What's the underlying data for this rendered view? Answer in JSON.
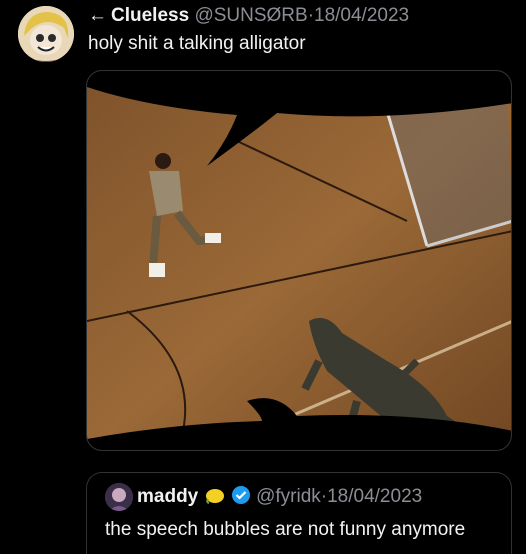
{
  "tweet": {
    "back_arrow": "←",
    "display_name": "Clueless",
    "handle": "@SUNSØRB",
    "separator": "·",
    "date": "18/04/2023",
    "text": "holy shit a talking alligator",
    "avatar_icon": "anime-avatar-icon",
    "media_description_icons": [
      "speech-bubble-icon",
      "alligator-icon"
    ]
  },
  "quote": {
    "display_name": "maddy",
    "handle": "@fyridk",
    "separator": "·",
    "date": "18/04/2023",
    "text": "the speech bubbles are not funny anymore",
    "badge_icons": [
      "lemon-icon",
      "verified-badge-icon"
    ],
    "verified_color": "#1d9bf0"
  },
  "colors": {
    "background": "#000000",
    "text": "#e7e9ea",
    "muted": "#8b8f94",
    "border": "#2f3336"
  }
}
